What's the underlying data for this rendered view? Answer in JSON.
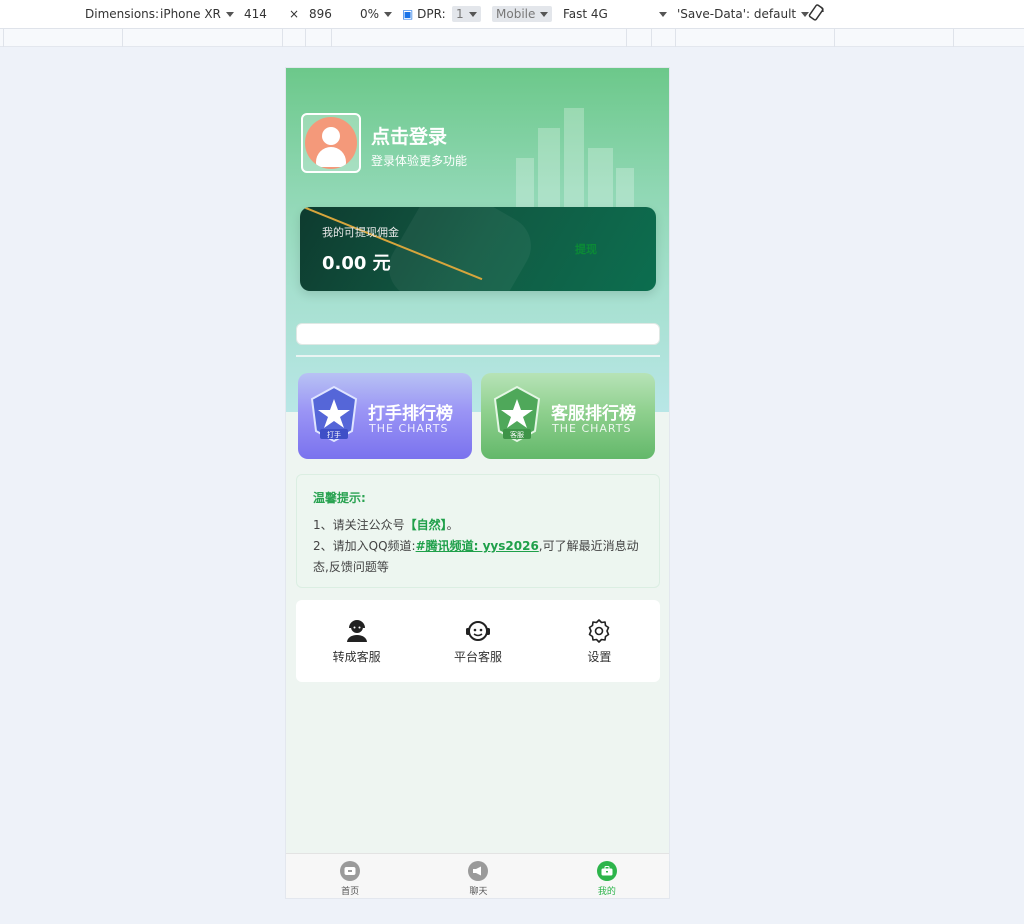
{
  "devtools": {
    "dimensions_label": "Dimensions:",
    "device": "iPhone XR",
    "width": "414",
    "times": "×",
    "height": "896",
    "zoom": "0%",
    "dpr_label": "DPR:",
    "dpr": "1",
    "mode": "Mobile",
    "network": "Fast 4G",
    "save_data": "'Save-Data': default"
  },
  "profile": {
    "title": "点击登录",
    "subtitle": "登录体验更多功能"
  },
  "wallet": {
    "label": "我的可提现佣金",
    "amount": "0.00 元",
    "action": "提现"
  },
  "rankings": [
    {
      "title": "打手排行榜",
      "subtitle": "THE CHARTS",
      "badge": "打手",
      "color": "#7a72ee"
    },
    {
      "title": "客服排行榜",
      "subtitle": "THE CHARTS",
      "badge": "客服",
      "color": "#63b86a"
    }
  ],
  "tips": {
    "heading": "温馨提示:",
    "line1_prefix": "1、请关注公众号",
    "line1_highlight": "【自然】",
    "line1_suffix": "。",
    "line2_prefix": "2、请加入QQ频道:",
    "line2_link": "#腾讯频道: yys2026",
    "line2_suffix": ",可了解最近消息动态,反馈问题等"
  },
  "tools": [
    {
      "label": "转成客服",
      "icon": "user-headset-icon"
    },
    {
      "label": "平台客服",
      "icon": "support-face-icon"
    },
    {
      "label": "设置",
      "icon": "gear-icon"
    }
  ],
  "tabbar": [
    {
      "label": "首页",
      "icon": "home-icon",
      "active": false
    },
    {
      "label": "聊天",
      "icon": "megaphone-icon",
      "active": false
    },
    {
      "label": "我的",
      "icon": "briefcase-icon",
      "active": true
    }
  ],
  "colors": {
    "accent": "#2db44b",
    "player": "#7a72ee",
    "service": "#63b86a"
  }
}
